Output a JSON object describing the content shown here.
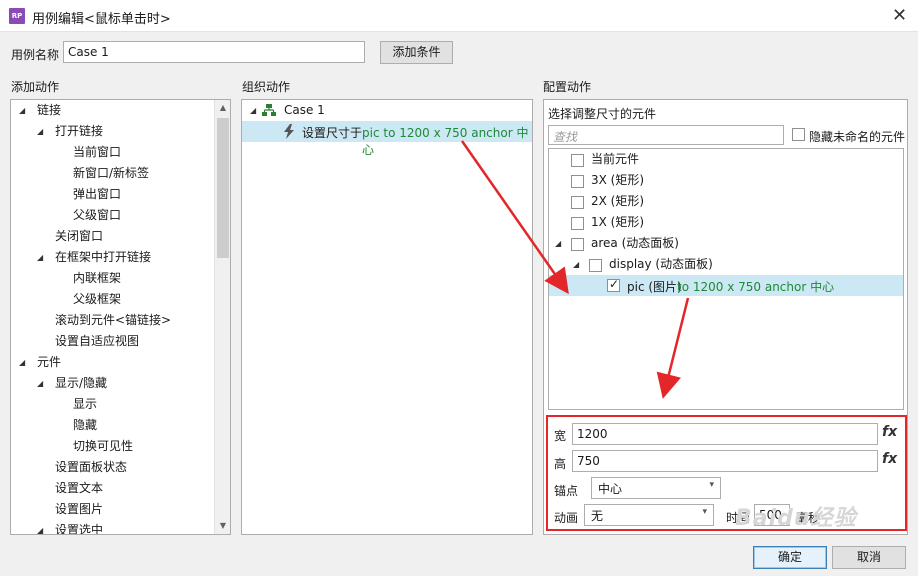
{
  "window": {
    "title": "用例编辑<鼠标单击时>",
    "app_icon": "RP"
  },
  "case_name": {
    "label": "用例名称",
    "value": "Case 1",
    "add_condition": "添加条件"
  },
  "columns": {
    "add_action": "添加动作",
    "organize_action": "组织动作",
    "config_action": "配置动作"
  },
  "add_action_tree": [
    {
      "label": "链接",
      "level": 0,
      "expanded": true
    },
    {
      "label": "打开链接",
      "level": 1,
      "expanded": true
    },
    {
      "label": "当前窗口",
      "level": 2
    },
    {
      "label": "新窗口/新标签",
      "level": 2
    },
    {
      "label": "弹出窗口",
      "level": 2
    },
    {
      "label": "父级窗口",
      "level": 2
    },
    {
      "label": "关闭窗口",
      "level": 1
    },
    {
      "label": "在框架中打开链接",
      "level": 1,
      "expanded": true
    },
    {
      "label": "内联框架",
      "level": 2
    },
    {
      "label": "父级框架",
      "level": 2
    },
    {
      "label": "滚动到元件<锚链接>",
      "level": 1
    },
    {
      "label": "设置自适应视图",
      "level": 1
    },
    {
      "label": "元件",
      "level": 0,
      "expanded": true
    },
    {
      "label": "显示/隐藏",
      "level": 1,
      "expanded": true
    },
    {
      "label": "显示",
      "level": 2
    },
    {
      "label": "隐藏",
      "level": 2
    },
    {
      "label": "切换可见性",
      "level": 2
    },
    {
      "label": "设置面板状态",
      "level": 1
    },
    {
      "label": "设置文本",
      "level": 1
    },
    {
      "label": "设置图片",
      "level": 1
    },
    {
      "label": "设置选中",
      "level": 1,
      "expanded": true
    }
  ],
  "organize": {
    "case_label": "Case 1",
    "action_prefix": "设置尺寸于",
    "action_detail": "pic to 1200 x 750 anchor 中心"
  },
  "config": {
    "heading": "选择调整尺寸的元件",
    "search_placeholder": "查找",
    "hide_unnamed": "隐藏未命名的元件",
    "widgets": [
      {
        "label": "当前元件"
      },
      {
        "label": "3X (矩形)"
      },
      {
        "label": "2X (矩形)"
      },
      {
        "label": "1X (矩形)"
      },
      {
        "label": "area (动态面板)"
      },
      {
        "label": "display (动态面板)"
      },
      {
        "label": "pic (图片)",
        "detail": "to 1200 x 750 anchor 中心"
      }
    ],
    "width_label": "宽",
    "width_value": "1200",
    "height_label": "高",
    "height_value": "750",
    "fx": "fx",
    "anchor_label": "锚点",
    "anchor_value": "中心",
    "animation_label": "动画",
    "animation_value": "无",
    "time_label": "时间",
    "time_value": "500",
    "ms_label": "毫秒"
  },
  "buttons": {
    "ok": "确定",
    "cancel": "取消"
  },
  "watermark": "Baidu经验",
  "colors": {
    "selection": "#cce8f4",
    "highlight_box": "#e2262a",
    "action_text": "#1e8a35"
  }
}
